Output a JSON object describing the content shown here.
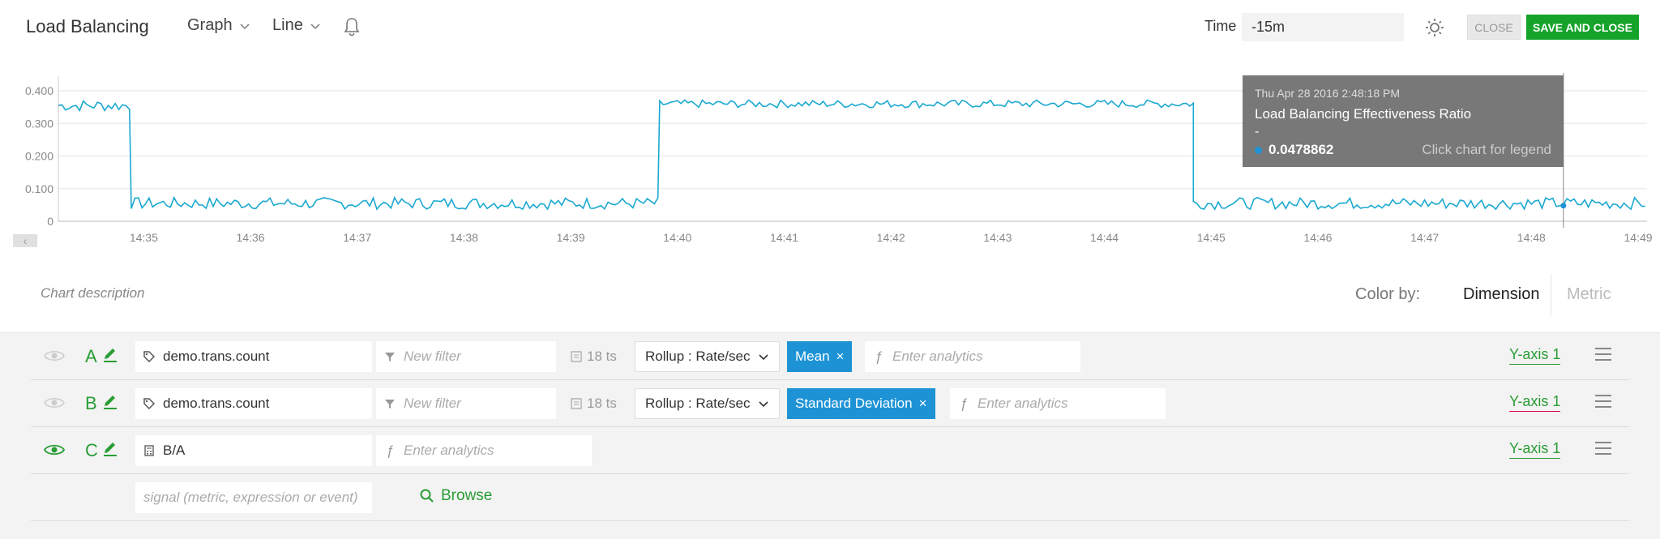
{
  "header": {
    "title": "Load Balancing",
    "graph_label": "Graph",
    "line_label": "Line",
    "time_label": "Time",
    "time_value": "-15m",
    "close_label": "CLOSE",
    "save_label": "SAVE AND CLOSE"
  },
  "chart_data": {
    "type": "line",
    "x_ticks": [
      "14:35",
      "14:36",
      "14:37",
      "14:38",
      "14:39",
      "14:40",
      "14:41",
      "14:42",
      "14:43",
      "14:44",
      "14:45",
      "14:46",
      "14:47",
      "14:48",
      "14:49"
    ],
    "y_ticks": [
      "0",
      "0.100",
      "0.200",
      "0.300",
      "0.400"
    ],
    "ylim": [
      0,
      0.42
    ],
    "xlim": [
      "14:34:12",
      "14:49:05"
    ],
    "grid": true,
    "series": [
      {
        "color": "#1aa8d0",
        "segments": [
          {
            "from": "14:34:12",
            "to": "14:34:53",
            "mean": 0.355,
            "noise": 0.018
          },
          {
            "from": "14:34:53",
            "to": "14:39:50",
            "mean": 0.055,
            "noise": 0.018
          },
          {
            "from": "14:39:50",
            "to": "14:44:50",
            "mean": 0.36,
            "noise": 0.012
          },
          {
            "from": "14:44:50",
            "to": "14:49:05",
            "mean": 0.055,
            "noise": 0.018
          }
        ]
      }
    ],
    "cursor_time": "14:48:18",
    "tooltip": {
      "date": "Thu Apr 28 2016 2:48:18 PM",
      "name": "Load Balancing Effectiveness Ratio",
      "dash": "-",
      "value": "0.0478862",
      "hint": "Click chart for legend"
    }
  },
  "description": {
    "placeholder": "Chart description",
    "color_by_label": "Color by:",
    "option_dimension": "Dimension",
    "option_metric": "Metric"
  },
  "plots": [
    {
      "letter": "A",
      "signal": "demo.trans.count",
      "filter_placeholder": "New filter",
      "ts": "18 ts",
      "rollup": "Rollup : Rate/sec",
      "analytic": "Mean",
      "analytics_placeholder": "Enter analytics",
      "yaxis": "Y-axis 1",
      "visible": false
    },
    {
      "letter": "B",
      "signal": "demo.trans.count",
      "filter_placeholder": "New filter",
      "ts": "18 ts",
      "rollup": "Rollup : Rate/sec",
      "analytic": "Standard Deviation",
      "analytics_placeholder": "Enter analytics",
      "yaxis": "Y-axis 1",
      "visible": false
    },
    {
      "letter": "C",
      "signal": "B/A",
      "analytics_placeholder": "Enter analytics",
      "yaxis": "Y-axis 1",
      "visible": true
    }
  ],
  "new_signal": {
    "placeholder": "signal (metric, expression or event)",
    "browse_label": "Browse"
  }
}
